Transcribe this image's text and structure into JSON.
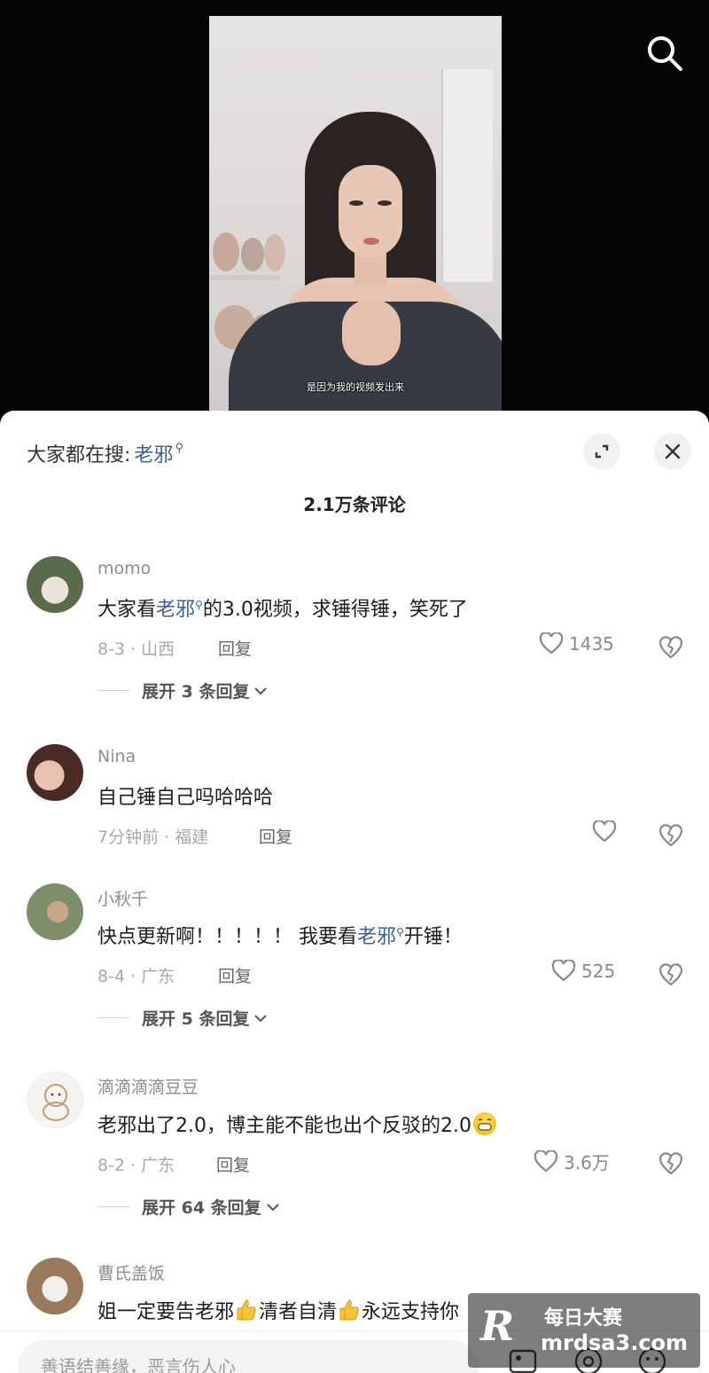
{
  "video": {
    "subtitle": "是因为我的视频发出来"
  },
  "header": {
    "hot_search_label": "大家都在搜:",
    "hot_search_keyword": "老邪",
    "comment_count": "2.1万条评论"
  },
  "comments": [
    {
      "username": "momo",
      "text_before": "大家看",
      "keyword": "老邪",
      "text_after": "的3.0视频，求锤得锤，笑死了",
      "meta": "8-3 · 山西",
      "reply_label": "回复",
      "likes": "1435",
      "expand": "展开 3 条回复"
    },
    {
      "username": "Nina",
      "text": "自己锤自己吗哈哈哈",
      "meta": "7分钟前 · 福建",
      "reply_label": "回复",
      "likes": ""
    },
    {
      "username": "小秋千",
      "text_before": "快点更新啊！！！！！ 我要看",
      "keyword": "老邪",
      "text_after": "开锤！",
      "meta": "8-4 · 广东",
      "reply_label": "回复",
      "likes": "525",
      "expand": "展开 5 条回复"
    },
    {
      "username": "滴滴滴滴豆豆",
      "text": "老邪出了2.0，博主能不能也出个反驳的2.0",
      "meta": "8-2 · 广东",
      "reply_label": "回复",
      "likes": "3.6万",
      "expand": "展开 64 条回复"
    },
    {
      "username": "曹氏盖饭",
      "text_a": "姐一定要告老邪",
      "text_b": "清者自清",
      "text_c": "永远支持你"
    }
  ],
  "input": {
    "placeholder": "善语结善缘，恶言伤人心"
  },
  "watermark": {
    "logo": "R",
    "title": "每日大赛",
    "url": "mrdsa3.com"
  },
  "colors": {
    "keyword": "#3b5f9a",
    "meta": "#a8a8a8",
    "background_video": "#050505"
  },
  "icons": [
    "search-icon",
    "expand-icon",
    "close-icon",
    "heart-icon",
    "broken-heart-icon",
    "chevron-down-icon",
    "image-icon",
    "at-icon",
    "emoji-icon",
    "thumbs-up-icon",
    "grin-emoji"
  ]
}
